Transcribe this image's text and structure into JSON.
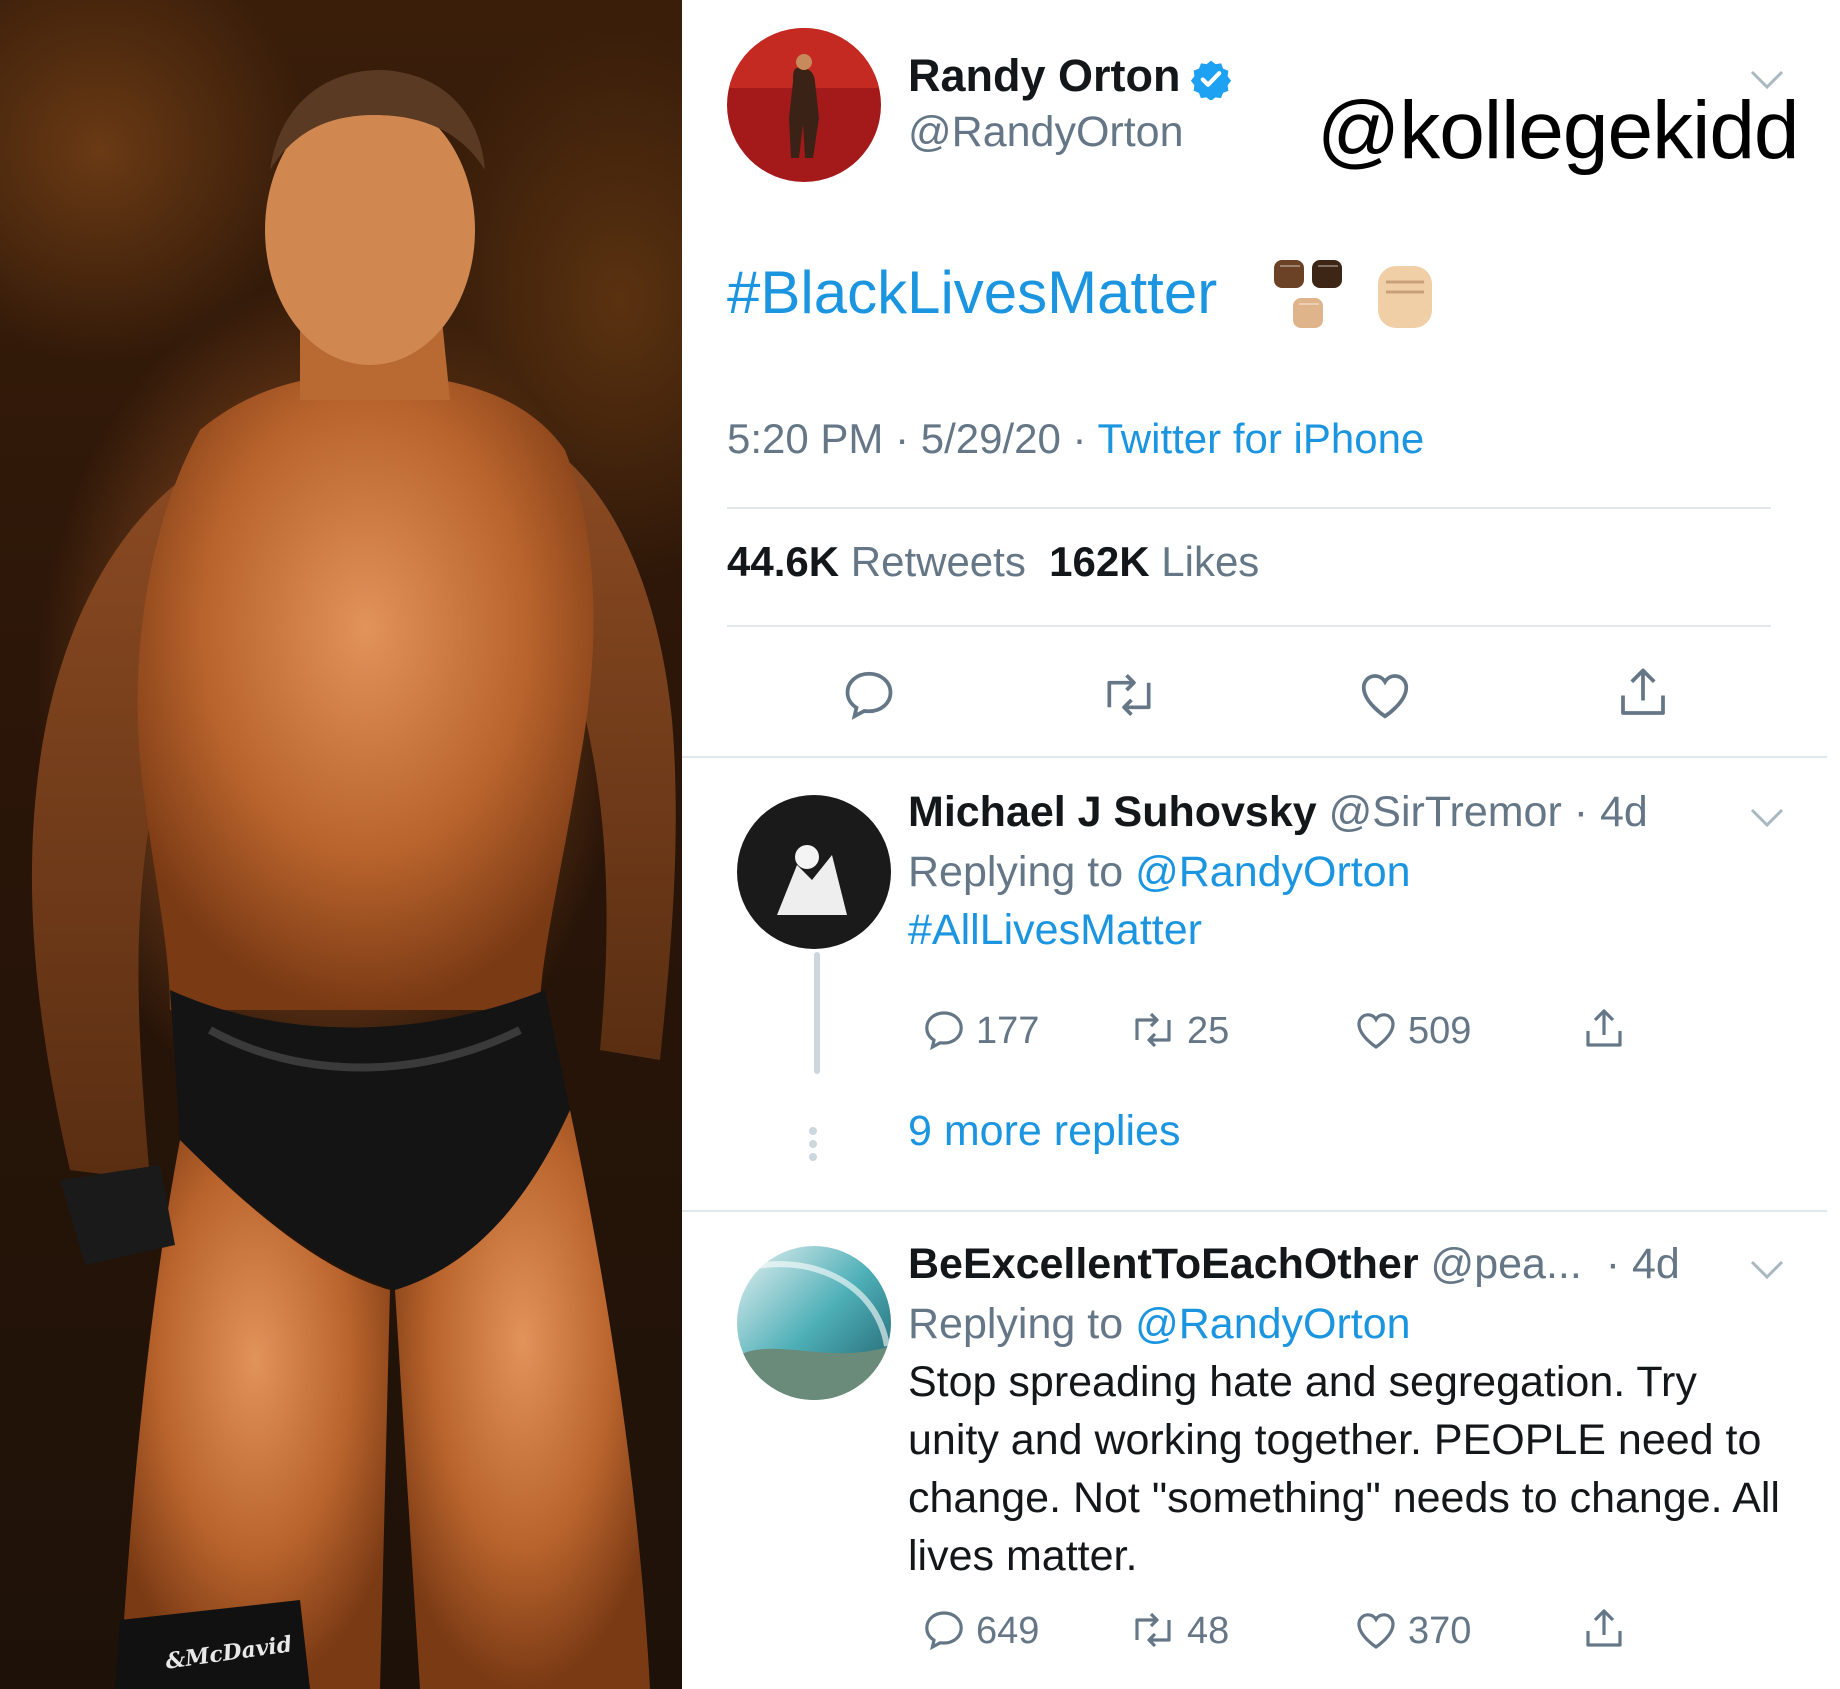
{
  "photo": {
    "watermark": "McDavid"
  },
  "watermark_handle": "@kollegekidd",
  "tweet": {
    "author_name": "Randy Orton",
    "author_handle": "@RandyOrton",
    "verified": true,
    "text": "#BlackLivesMatter",
    "time": "5:20 PM",
    "date": "5/29/20",
    "source": "Twitter for iPhone",
    "retweets_count": "44.6K",
    "retweets_label": "Retweets",
    "likes_count": "162K",
    "likes_label": "Likes",
    "actions": [
      "reply-icon",
      "retweet-icon",
      "like-icon",
      "share-icon"
    ]
  },
  "replies": [
    {
      "name": "Michael J Suhovsky",
      "handle": "@SirTremor",
      "age": "4d",
      "replying_to_label": "Replying to",
      "replying_to_handle": "@RandyOrton",
      "text": "#AllLivesMatter",
      "reply_count": "177",
      "retweet_count": "25",
      "like_count": "509",
      "more_replies": "9 more replies"
    },
    {
      "name": "BeExcellentToEachOther",
      "handle": "@pea...",
      "age": "4d",
      "replying_to_label": "Replying to",
      "replying_to_handle": "@RandyOrton",
      "text": "Stop spreading hate and segregation. Try unity and working together. PEOPLE need to change. Not \"something\" needs to change. All lives matter.",
      "reply_count": "649",
      "retweet_count": "48",
      "like_count": "370"
    }
  ],
  "colors": {
    "link_blue": "#1b95e0",
    "secondary_gray": "#657786",
    "divider": "#e1e8ed",
    "verified_blue": "#1da1f2"
  }
}
